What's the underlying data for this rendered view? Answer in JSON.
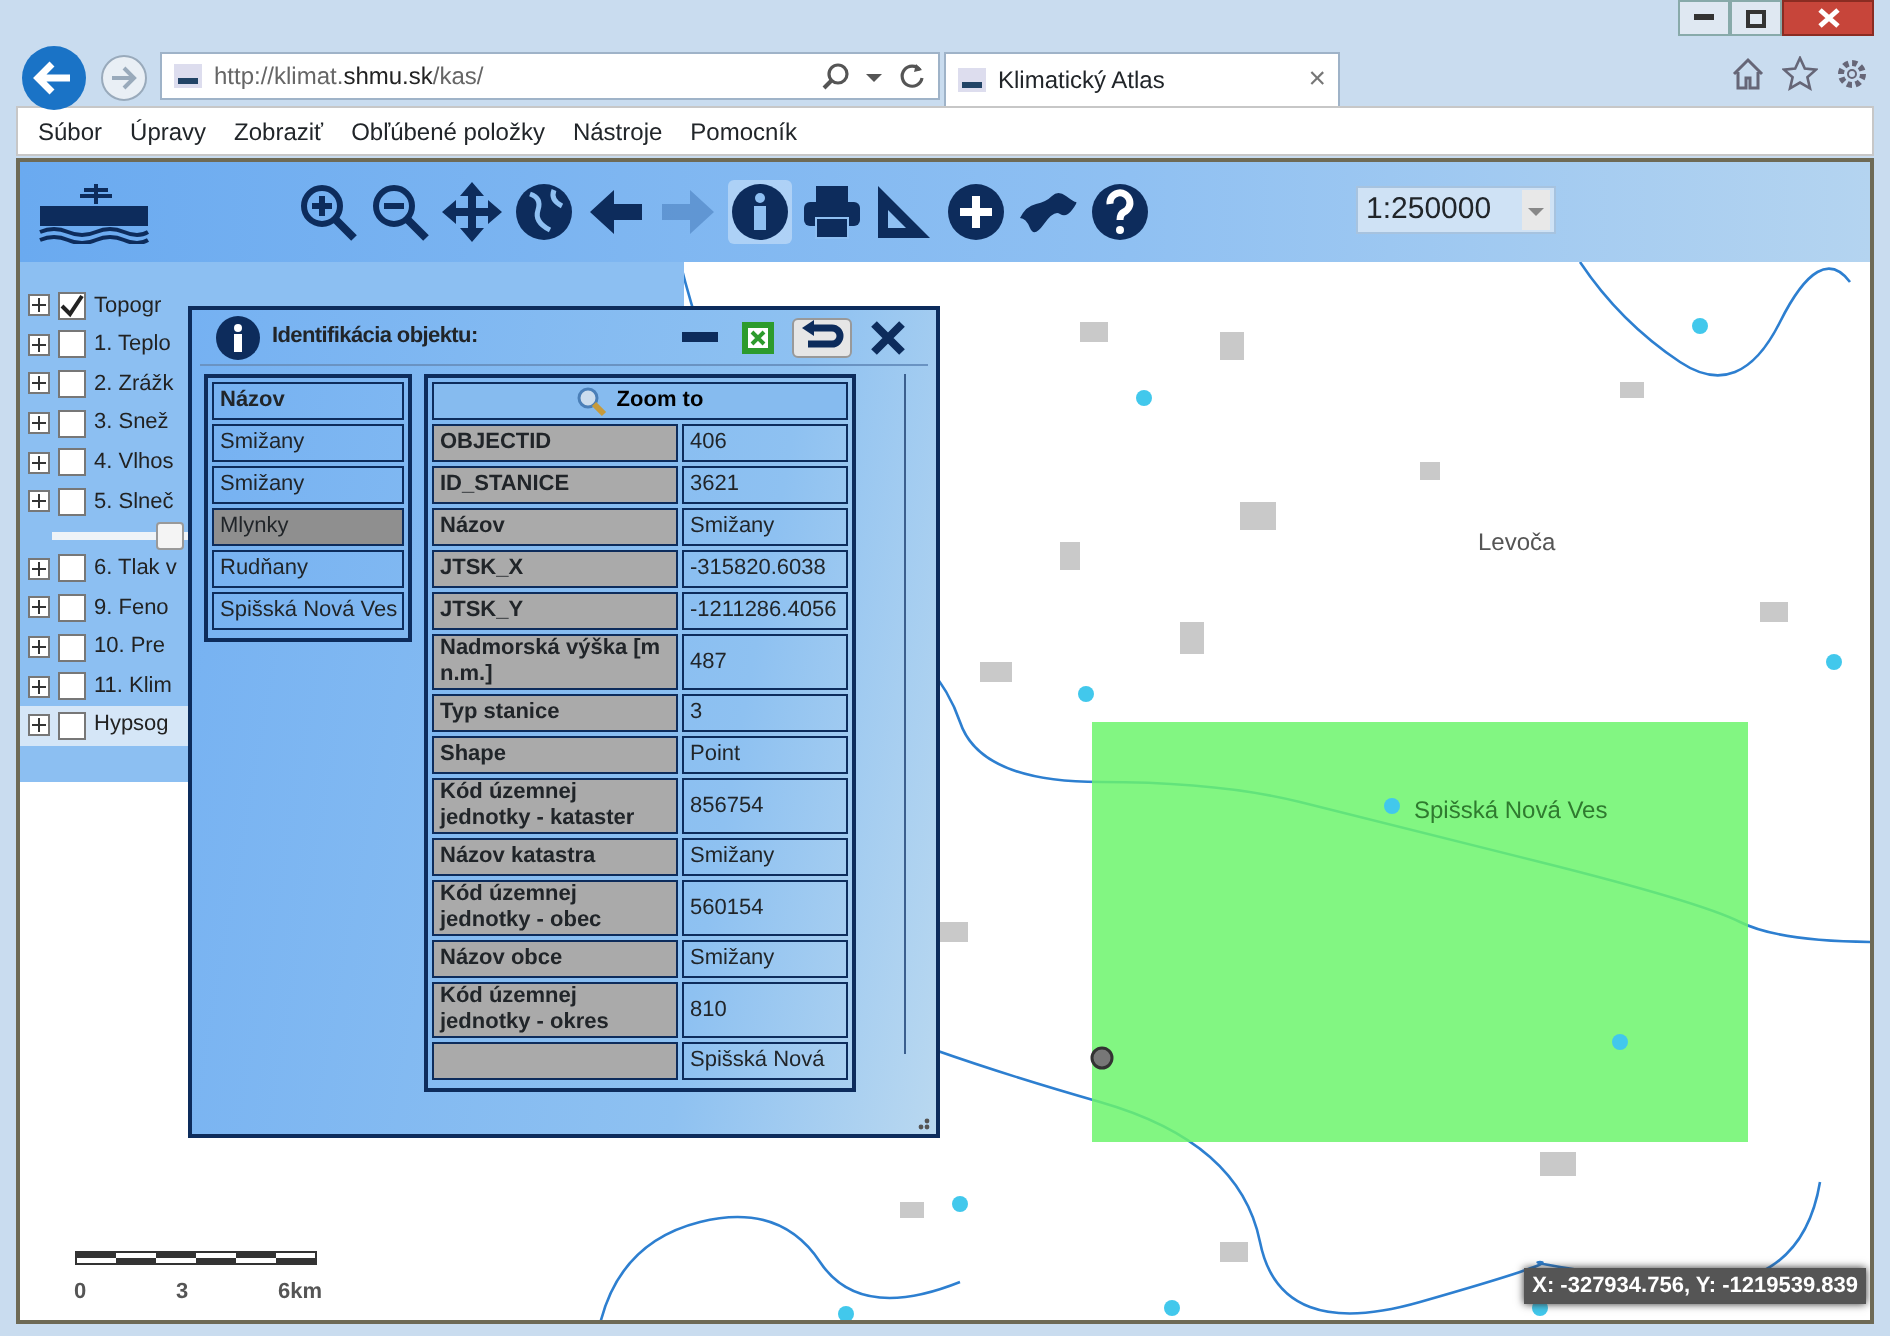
{
  "browser": {
    "address": "http://klimat.**shmu.sk**/kas/",
    "tab": {
      "title": "Klimatický Atlas",
      "close": "×"
    }
  },
  "menu": [
    "Súbor",
    "Úpravy",
    "Zobraziť",
    "Obľúbené položky",
    "Nástroje",
    "Pomocník"
  ],
  "toolbar": {
    "tools": [
      {
        "kind": "zoom-in",
        "selected": false,
        "disabled": false
      },
      {
        "kind": "zoom-out",
        "selected": false,
        "disabled": false
      },
      {
        "kind": "pan",
        "selected": false,
        "disabled": false
      },
      {
        "kind": "globe",
        "selected": false,
        "disabled": false
      },
      {
        "kind": "back",
        "selected": false,
        "disabled": false
      },
      {
        "kind": "forward",
        "selected": false,
        "disabled": true
      },
      {
        "kind": "info",
        "selected": true,
        "disabled": false
      },
      {
        "kind": "print",
        "selected": false,
        "disabled": false
      },
      {
        "kind": "measure",
        "selected": false,
        "disabled": false
      },
      {
        "kind": "add",
        "selected": false,
        "disabled": false
      },
      {
        "kind": "country",
        "selected": false,
        "disabled": false
      },
      {
        "kind": "help",
        "selected": false,
        "disabled": false
      }
    ],
    "scale": "1:250000"
  },
  "layers": [
    {
      "kind": "layer",
      "label": "Topogr",
      "checked": true,
      "highlighted": false
    },
    {
      "kind": "layer",
      "label": "1. Teplo",
      "checked": false,
      "highlighted": false
    },
    {
      "kind": "layer",
      "label": "2. Zrážk",
      "checked": false,
      "highlighted": false
    },
    {
      "kind": "layer",
      "label": "3. Snež",
      "checked": false,
      "highlighted": false
    },
    {
      "kind": "layer",
      "label": "4. Vlhos",
      "checked": false,
      "highlighted": false
    },
    {
      "kind": "layer",
      "label": "5. Slneč",
      "checked": false,
      "highlighted": false
    },
    {
      "kind": "slider",
      "level": 0.42
    },
    {
      "kind": "layer",
      "label": "6. Tlak v",
      "checked": false,
      "highlighted": false
    },
    {
      "kind": "layer",
      "label": "9. Feno",
      "checked": false,
      "highlighted": false
    },
    {
      "kind": "layer",
      "label": "10. Pre",
      "checked": false,
      "highlighted": false
    },
    {
      "kind": "layer",
      "label": "11. Klim",
      "checked": false,
      "highlighted": false
    },
    {
      "kind": "layer",
      "label": "Hypsog",
      "checked": false,
      "highlighted": true
    }
  ],
  "dialog": {
    "title": "Identifikácia objektu:",
    "list_header": "Názov",
    "items": [
      {
        "label": "Smižany",
        "selected": false
      },
      {
        "label": "Smižany",
        "selected": false
      },
      {
        "label": "Mlynky",
        "selected": true
      },
      {
        "label": "Rudňany",
        "selected": false
      },
      {
        "label": "Spišská Nová Ves",
        "selected": false
      }
    ],
    "zoom_button": "Zoom to",
    "rows": [
      {
        "key": "OBJECTID",
        "value": "406"
      },
      {
        "key": "ID_STANICE",
        "value": "3621"
      },
      {
        "key": "Názov",
        "value": "Smižany"
      },
      {
        "key": "JTSK_X",
        "value": "-315820.6038"
      },
      {
        "key": "JTSK_Y",
        "value": "-1211286.4056"
      },
      {
        "key": "Nadmorská výška [m n.m.]",
        "value": "487"
      },
      {
        "key": "Typ stanice",
        "value": "3"
      },
      {
        "key": "Shape",
        "value": "Point"
      },
      {
        "key": "Kód územnej jednotky - kataster",
        "value": "856754"
      },
      {
        "key": "Názov katastra",
        "value": "Smižany"
      },
      {
        "key": "Kód územnej jednotky - obec",
        "value": "560154"
      },
      {
        "key": "Názov obce",
        "value": "Smižany"
      },
      {
        "key": "Kód územnej jednotky - okres",
        "value": "810"
      },
      {
        "value": "Spišská Nová"
      }
    ]
  },
  "map": {
    "labels": [
      "Levoča",
      "Spišská Nová Ves"
    ],
    "scale_labels": [
      "0",
      "3",
      "6km"
    ],
    "coordinates": "X: -327934.756, Y: -1219539.839"
  }
}
